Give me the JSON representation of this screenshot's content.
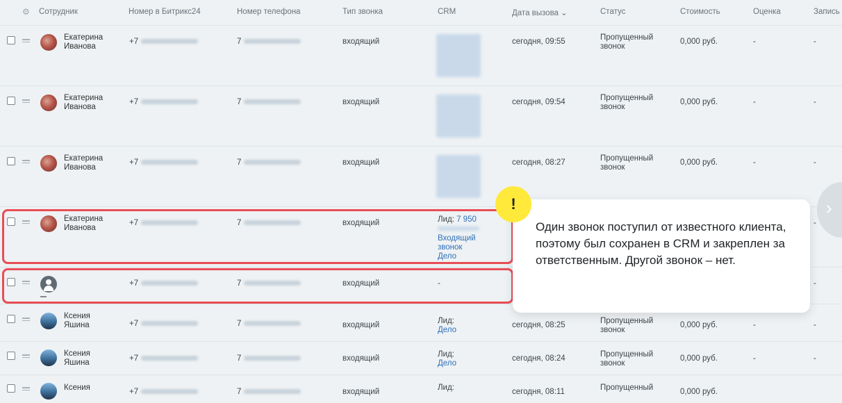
{
  "columns": {
    "employee": "Сотрудник",
    "bitrix_number": "Номер в Битрикс24",
    "phone": "Номер телефона",
    "call_type": "Тип звонка",
    "crm": "CRM",
    "call_date": "Дата вызова",
    "call_date_sort_icon": "chevron-down-icon",
    "status": "Статус",
    "cost": "Стоимость",
    "rating": "Оценка",
    "record": "Запись"
  },
  "rows": [
    {
      "first": "Екатерина",
      "last": "Иванова",
      "bitrix": "+7",
      "phone": "7",
      "type": "входящий",
      "date": "сегодня, 09:55",
      "status1": "Пропущенный",
      "status2": "звонок",
      "cost": "0,000 руб.",
      "rating": "-",
      "record": "-"
    },
    {
      "first": "Екатерина",
      "last": "Иванова",
      "bitrix": "+7",
      "phone": "7",
      "type": "входящий",
      "date": "сегодня, 09:54",
      "status1": "Пропущенный",
      "status2": "звонок",
      "cost": "0,000 руб.",
      "rating": "-",
      "record": "-"
    },
    {
      "first": "Екатерина",
      "last": "Иванова",
      "bitrix": "+7",
      "phone": "7",
      "type": "входящий",
      "date": "сегодня, 08:27",
      "status1": "Пропущенный",
      "status2": "звонок",
      "cost": "0,000 руб.",
      "rating": "-",
      "record": "-"
    },
    {
      "first": "Екатерина",
      "last": "Иванова",
      "bitrix": "+7",
      "phone": "7",
      "type": "входящий",
      "crm_lead_label": "Лид:",
      "crm_lead_value": "7 950",
      "crm_link1": "Входящий",
      "crm_link2": "звонок",
      "crm_link3": "Дело",
      "record": "-"
    },
    {
      "first": "",
      "last": "",
      "bitrix": "+7",
      "phone": "7",
      "type": "входящий",
      "crm_dash": "-",
      "record": "-"
    },
    {
      "first": "Ксения",
      "last": "Яшина",
      "bitrix": "+7",
      "phone": "7",
      "type": "входящий",
      "crm_lead_label": "Лид:",
      "crm_link3": "Дело",
      "date": "сегодня, 08:25",
      "status1": "Пропущенный",
      "status2": "звонок",
      "cost": "0,000 руб.",
      "rating": "-",
      "record": "-"
    },
    {
      "first": "Ксения",
      "last": "Яшина",
      "bitrix": "+7",
      "phone": "7",
      "type": "входящий",
      "crm_lead_label": "Лид:",
      "crm_link3": "Дело",
      "date": "сегодня, 08:24",
      "status1": "Пропущенный",
      "status2": "звонок",
      "cost": "0,000 руб.",
      "rating": "-",
      "record": "-"
    },
    {
      "first": "Ксения",
      "last": "",
      "bitrix": "+7",
      "phone": "7",
      "type": "входящий",
      "crm_lead_label": "Лид:",
      "date": "сегодня, 08:11",
      "status1": "Пропущенный",
      "cost": "0,000 руб."
    }
  ],
  "callout": {
    "text": "Один звонок поступил от известного клиента, поэтому был сохранен в CRM и закреплен за ответственным. Другой звонок – нет.",
    "marker": "!"
  },
  "icons": {
    "settings": "gear-icon",
    "next": "chevron-right-icon"
  },
  "colors": {
    "highlight": "#e94d55",
    "marker": "#ffe93b",
    "link": "#2f6fb8"
  }
}
